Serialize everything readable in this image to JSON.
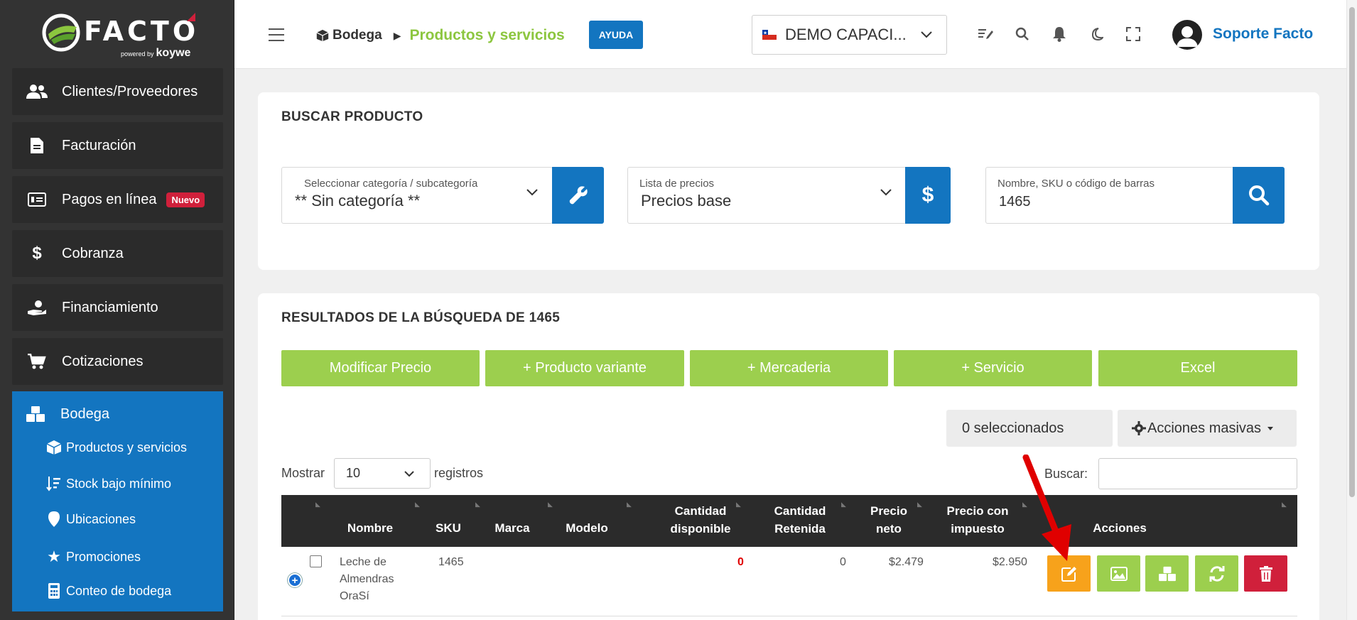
{
  "brand": {
    "name": "FACTO",
    "powered": "powered by",
    "sub": "koywe"
  },
  "sidebar": {
    "items": [
      {
        "label": "Clientes/Proveedores",
        "icon": "users-icon"
      },
      {
        "label": "Facturación",
        "icon": "file-icon"
      },
      {
        "label": "Pagos en línea",
        "icon": "payment-card-icon",
        "badge": "Nuevo"
      },
      {
        "label": "Cobranza",
        "icon": "dollar-icon"
      },
      {
        "label": "Financiamiento",
        "icon": "hand-coin-icon"
      },
      {
        "label": "Cotizaciones",
        "icon": "cart-icon"
      }
    ],
    "bodega": {
      "label": "Bodega",
      "icon": "boxes-icon",
      "sub_items": [
        {
          "label": "Productos y servicios",
          "icon": "box-icon"
        },
        {
          "label": "Stock bajo mínimo",
          "icon": "sort-amount-icon"
        },
        {
          "label": "Ubicaciones",
          "icon": "map-pin-icon"
        },
        {
          "label": "Promociones",
          "icon": "star-icon"
        },
        {
          "label": "Conteo de bodega",
          "icon": "calculator-icon"
        }
      ]
    }
  },
  "topbar": {
    "breadcrumb_parent": "Bodega",
    "breadcrumb_current": "Productos y servicios",
    "help_label": "AYUDA",
    "company": "DEMO CAPACI...",
    "user_name": "Soporte Facto"
  },
  "search_card": {
    "title": "BUSCAR PRODUCTO",
    "category_label": "Seleccionar categoría / subcategoría",
    "category_value": "** Sin categoría **",
    "pricelist_label": "Lista de precios",
    "pricelist_value": "Precios base",
    "query_label": "Nombre, SKU o código de barras",
    "query_value": "1465"
  },
  "results_card": {
    "title": "RESULTADOS DE LA BÚSQUEDA DE 1465",
    "buttons": [
      "Modificar Precio",
      "+ Producto variante",
      "+ Mercaderia",
      "+ Servicio",
      "Excel"
    ],
    "selected_count": "0 seleccionados",
    "bulk_actions": "Acciones masivas",
    "show_label": "Mostrar",
    "page_length": "10",
    "records_label": "registros",
    "search_label": "Buscar:"
  },
  "table": {
    "headers": {
      "name": "Nombre",
      "sku": "SKU",
      "brand": "Marca",
      "model": "Modelo",
      "qty_available_1": "Cantidad",
      "qty_available_2": "disponible",
      "qty_held_1": "Cantidad",
      "qty_held_2": "Retenida",
      "net_price_1": "Precio",
      "net_price_2": "neto",
      "tax_price_1": "Precio con",
      "tax_price_2": "impuesto",
      "actions": "Acciones"
    },
    "rows": [
      {
        "name_1": "Leche de",
        "name_2": "Almendras",
        "name_3": "OraSí",
        "sku": "1465",
        "brand": "",
        "model": "",
        "qty_available": "0",
        "qty_held": "0",
        "net_price": "$2.479",
        "tax_price": "$2.950"
      }
    ]
  },
  "colors": {
    "primary_blue": "#1375c0",
    "green": "#9ccf4e",
    "orange": "#f7a21b",
    "red": "#d0203b",
    "sidebar": "#333333"
  }
}
